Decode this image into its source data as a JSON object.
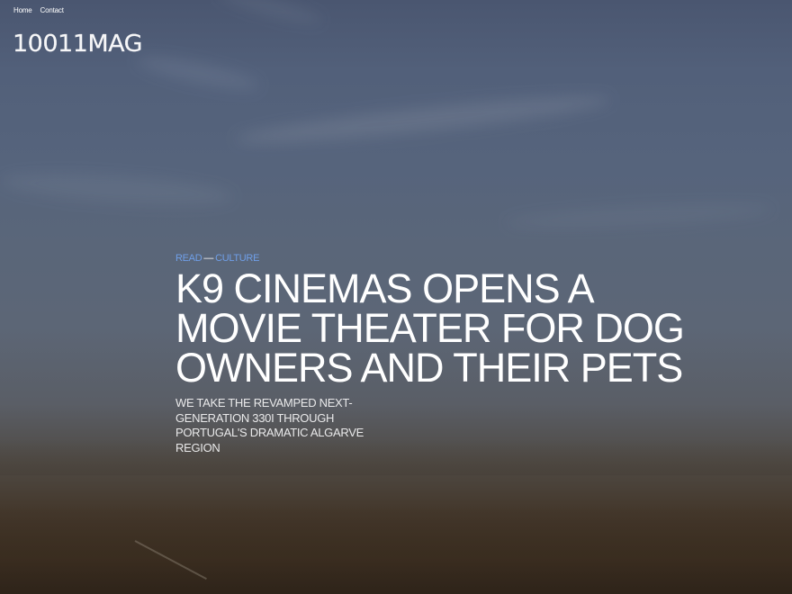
{
  "nav": {
    "home_label": "Home",
    "contact_label": "Contact"
  },
  "brand": {
    "logo_text": "10011MAG"
  },
  "article": {
    "category_primary": "READ",
    "category_separator": "—",
    "category_secondary": "CULTURE",
    "headline": "K9 CINEMAS OPENS A MOVIE THEATER FOR DOG OWNERS AND THEIR PETS",
    "subheadline": "WE TAKE THE REVAMPED NEXT-GENERATION 330I THROUGH PORTUGAL'S DRAMATIC ALGARVE REGION"
  },
  "colors": {
    "accent_link": "#6f9fe8",
    "text": "#ffffff"
  }
}
